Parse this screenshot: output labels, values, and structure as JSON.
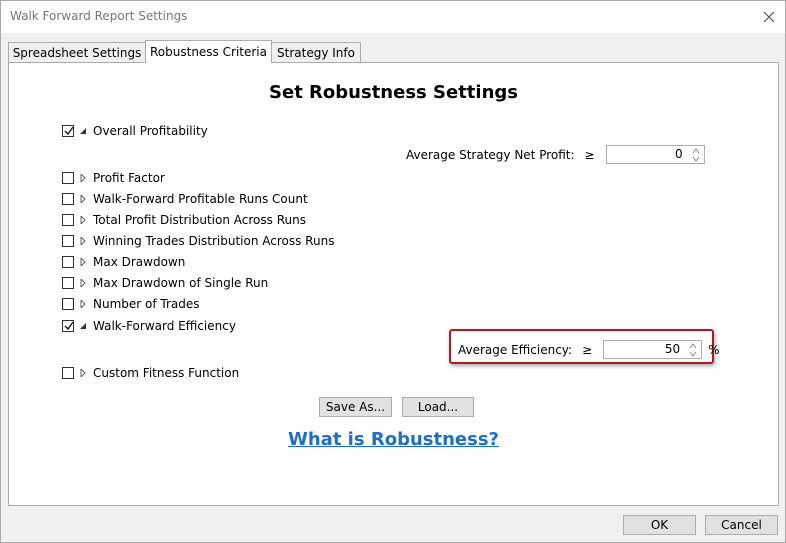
{
  "window": {
    "title": "Walk Forward Report Settings",
    "close_icon": "close-icon"
  },
  "tabs": [
    {
      "label": "Spreadsheet Settings",
      "active": false
    },
    {
      "label": "Robustness Criteria",
      "active": true
    },
    {
      "label": "Strategy Info",
      "active": false
    }
  ],
  "panel": {
    "heading": "Set Robustness Settings",
    "criteria": [
      {
        "label": "Overall Profitability",
        "checked": true,
        "expanded": true
      },
      {
        "label": "Profit Factor",
        "checked": false,
        "expanded": false
      },
      {
        "label": "Walk-Forward Profitable Runs Count",
        "checked": false,
        "expanded": false
      },
      {
        "label": "Total Profit Distribution Across Runs",
        "checked": false,
        "expanded": false
      },
      {
        "label": "Winning Trades Distribution Across Runs",
        "checked": false,
        "expanded": false
      },
      {
        "label": "Max Drawdown",
        "checked": false,
        "expanded": false
      },
      {
        "label": "Max Drawdown of Single Run",
        "checked": false,
        "expanded": false
      },
      {
        "label": "Number of Trades",
        "checked": false,
        "expanded": false
      },
      {
        "label": "Walk-Forward Efficiency",
        "checked": true,
        "expanded": true
      },
      {
        "label": "Custom Fitness Function",
        "checked": false,
        "expanded": false
      }
    ],
    "net_profit": {
      "label": "Average Strategy Net Profit:",
      "operator": "≥",
      "value": "0"
    },
    "efficiency": {
      "label": "Average Efficiency:",
      "operator": "≥",
      "value": "50",
      "unit": "%"
    },
    "save_as_label": "Save As...",
    "load_label": "Load...",
    "help_link": "What is Robustness?"
  },
  "footer": {
    "ok_label": "OK",
    "cancel_label": "Cancel"
  },
  "colors": {
    "link": "#1e6fc6",
    "highlight_border": "#b11a22"
  }
}
